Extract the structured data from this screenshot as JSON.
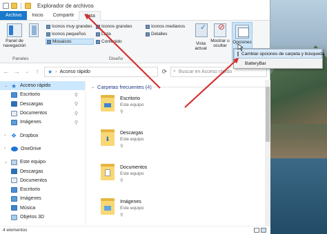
{
  "window": {
    "title": "Explorador de archivos"
  },
  "tabs": [
    {
      "label": "Archivo"
    },
    {
      "label": "Inicio"
    },
    {
      "label": "Compartir"
    },
    {
      "label": "Vista"
    }
  ],
  "ribbon": {
    "panels_group": {
      "button_label_1": "Panel de",
      "button_label_2": "navegación",
      "group_label": "Paneles"
    },
    "layout_items": [
      "Iconos muy grandes",
      "Iconos grandes",
      "Iconos medianos",
      "Iconos pequeños",
      "Lista",
      "Detalles",
      "Mosaicos",
      "Contenido",
      ""
    ],
    "layout_group_label": "Diseño",
    "current_view": {
      "label_1": "Vista",
      "label_2": "actual"
    },
    "show_hide": {
      "label_1": "Mostrar u",
      "label_2": "ocultar"
    },
    "options": {
      "label": "Opciones"
    }
  },
  "options_menu": {
    "items": [
      "Cambiar opciones de carpeta y búsqueda",
      "BatteryBar"
    ]
  },
  "address": {
    "path": "Acceso rápido",
    "search_placeholder": "Buscar en Acceso rápido"
  },
  "nav_pane": {
    "items": [
      {
        "label": "Acceso rápido",
        "icon": "star-icon"
      },
      {
        "label": "Escritorio",
        "icon": "desktop-folder-icon"
      },
      {
        "label": "Descargas",
        "icon": "downloads-folder-icon"
      },
      {
        "label": "Documentos",
        "icon": "documents-folder-icon"
      },
      {
        "label": "Imágenes",
        "icon": "pictures-folder-icon"
      },
      {
        "label": "Dropbox",
        "icon": "dropbox-icon"
      },
      {
        "label": "OneDrive",
        "icon": "onedrive-icon"
      },
      {
        "label": "Este equipo",
        "icon": "this-pc-icon"
      },
      {
        "label": "Descargas",
        "icon": "downloads-folder-icon"
      },
      {
        "label": "Documentos",
        "icon": "documents-folder-icon"
      },
      {
        "label": "Escritorio",
        "icon": "desktop-folder-icon"
      },
      {
        "label": "Imágenes",
        "icon": "pictures-folder-icon"
      },
      {
        "label": "Música",
        "icon": "music-folder-icon"
      },
      {
        "label": "Objetos 3D",
        "icon": "3d-objects-folder-icon"
      }
    ]
  },
  "main": {
    "section_title": "Carpetas frecuentes (4)",
    "tiles": [
      {
        "name": "Escritorio",
        "location": "Este equipo",
        "icon": "desktop-folder-icon"
      },
      {
        "name": "Descargas",
        "location": "Este equipo",
        "icon": "downloads-folder-icon"
      },
      {
        "name": "Documentos",
        "location": "Este equipo",
        "icon": "documents-folder-icon"
      },
      {
        "name": "Imágenes",
        "location": "Este equipo",
        "icon": "pictures-folder-icon"
      }
    ]
  },
  "status": {
    "items_count": "4 elementos"
  },
  "colors": {
    "file_tab": "#1979ca",
    "selection": "#cce8ff",
    "annotation_arrow": "#d32f2f"
  }
}
